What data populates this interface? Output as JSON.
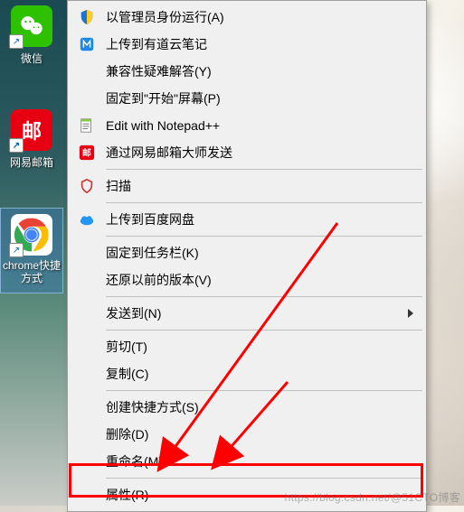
{
  "desktop": {
    "icons": [
      {
        "name": "wechat",
        "label": "微信"
      },
      {
        "name": "netmail",
        "label": "网易邮箱"
      },
      {
        "name": "chrome",
        "label": "chrome快捷方式"
      }
    ]
  },
  "menu": {
    "items": {
      "run_admin": "以管理员身份运行(A)",
      "youdao": "上传到有道云笔记",
      "compat": "兼容性疑难解答(Y)",
      "pin_start": "固定到\"开始\"屏幕(P)",
      "notepad": "Edit with Notepad++",
      "netease_send": "通过网易邮箱大师发送",
      "scan": "扫描",
      "baidu": "上传到百度网盘",
      "pin_taskbar": "固定到任务栏(K)",
      "restore": "还原以前的版本(V)",
      "send_to": "发送到(N)",
      "cut": "剪切(T)",
      "copy": "复制(C)",
      "shortcut": "创建快捷方式(S)",
      "delete": "删除(D)",
      "rename": "重命名(M)",
      "properties": "属性(R)"
    }
  },
  "watermark": "https://blog.csdn.net/@51CTO博客"
}
